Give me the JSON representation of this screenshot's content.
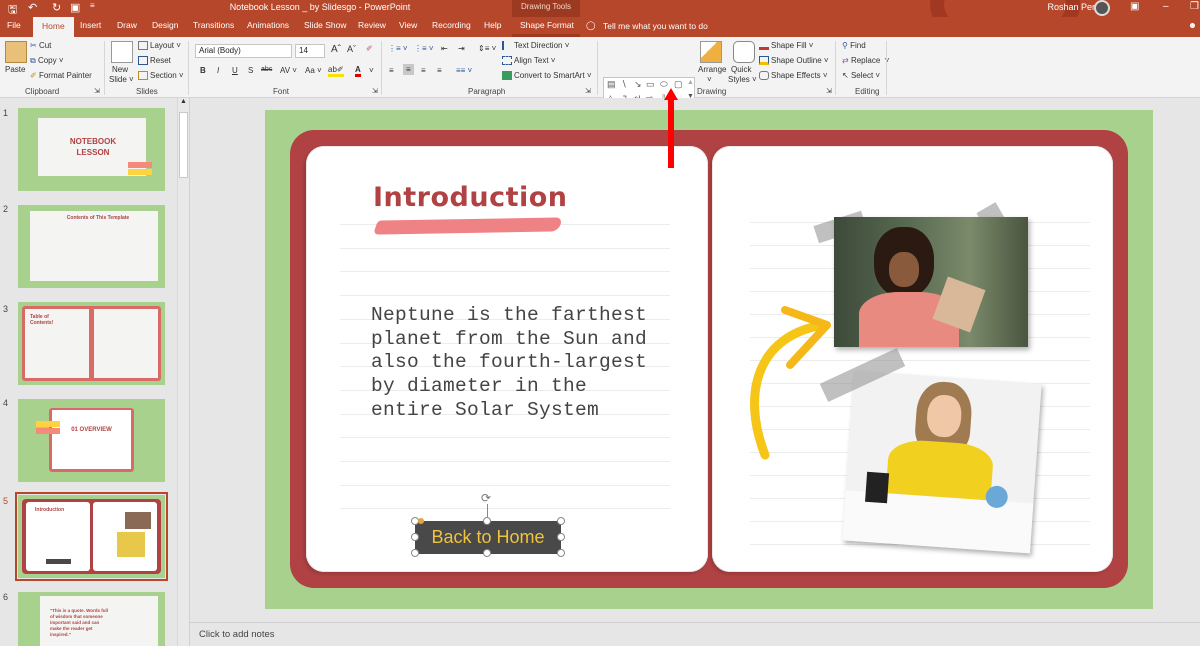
{
  "window": {
    "title": "Notebook Lesson _ by Slidesgo  -  PowerPoint",
    "contextual_group": "Drawing Tools",
    "user_name": "Roshan Perera"
  },
  "qat": {
    "save_icon": "save-icon",
    "undo_icon": "undo-icon",
    "redo_icon": "redo-icon",
    "present_icon": "start-slideshow-icon"
  },
  "tabs": [
    {
      "label": "File"
    },
    {
      "label": "Home",
      "active": true
    },
    {
      "label": "Insert"
    },
    {
      "label": "Draw"
    },
    {
      "label": "Design"
    },
    {
      "label": "Transitions"
    },
    {
      "label": "Animations"
    },
    {
      "label": "Slide Show"
    },
    {
      "label": "Review"
    },
    {
      "label": "View"
    },
    {
      "label": "Recording"
    },
    {
      "label": "Help"
    },
    {
      "label": "Shape Format"
    }
  ],
  "tell_me": "Tell me what you want to do",
  "ribbon": {
    "clipboard": {
      "label": "Clipboard",
      "paste": "Paste",
      "cut": "Cut",
      "copy": "Copy",
      "format_painter": "Format Painter"
    },
    "slides": {
      "label": "Slides",
      "new_slide_1": "New",
      "new_slide_2": "Slide",
      "layout": "Layout",
      "reset": "Reset",
      "section": "Section"
    },
    "font": {
      "label": "Font",
      "font_name": "Arial (Body)",
      "font_size": "14",
      "bold": "B",
      "italic": "I",
      "underline": "U",
      "shadow": "S",
      "strike": "abc",
      "spacing": "AV",
      "case": "Aa"
    },
    "paragraph": {
      "label": "Paragraph",
      "text_direction": "Text Direction",
      "align_text": "Align Text",
      "convert_smartart": "Convert to SmartArt"
    },
    "drawing": {
      "label": "Drawing",
      "arrange": "Arrange",
      "quick_styles_1": "Quick",
      "quick_styles_2": "Styles",
      "shape_fill": "Shape Fill",
      "shape_outline": "Shape Outline",
      "shape_effects": "Shape Effects"
    },
    "editing": {
      "label": "Editing",
      "find": "Find",
      "replace": "Replace",
      "select": "Select"
    }
  },
  "thumbnails": [
    {
      "num": "1",
      "title": "NOTEBOOK LESSON"
    },
    {
      "num": "2",
      "title": "Contents of This Template"
    },
    {
      "num": "3",
      "title": "Table of Contents!"
    },
    {
      "num": "4",
      "title": "01 OVERVIEW"
    },
    {
      "num": "5",
      "title": "Introduction",
      "selected": true
    },
    {
      "num": "6",
      "title": "\"This is a quote. Words full of wisdom that someone important said and can make the reader get inspired.\""
    }
  ],
  "slide": {
    "title": "Introduction",
    "body": "Neptune is the farthest planet from the Sun and also the fourth-largest by diameter in the entire Solar System",
    "button": "Back to Home",
    "colors": {
      "background": "#a9d18e",
      "book": "#b04243",
      "title": "#b04243",
      "button_bg": "#494949",
      "button_text": "#f0c33c",
      "arrow": "#f5c518"
    }
  },
  "notes_placeholder": "Click to add notes",
  "annotation": {
    "color": "#ff0000",
    "points_to": "shapes gallery"
  }
}
